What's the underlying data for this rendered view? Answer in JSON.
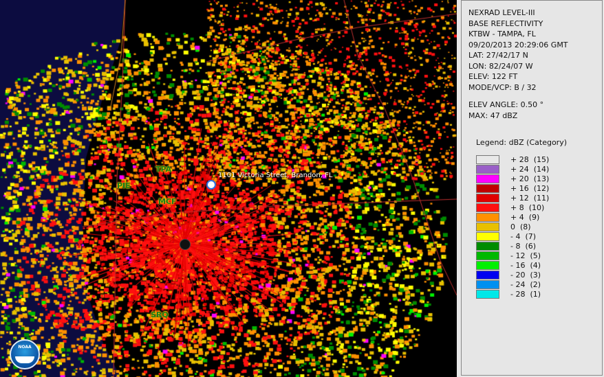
{
  "info": {
    "lines": [
      "NEXRAD LEVEL-III",
      "BASE REFLECTIVITY",
      "KTBW - TAMPA, FL",
      "09/20/2013 20:29:06 GMT",
      "LAT: 27/42/17 N",
      "LON: 82/24/07 W",
      "ELEV: 122 FT",
      "MODE/VCP: B / 32"
    ],
    "elev_angle": "ELEV ANGLE: 0.50 °",
    "max": "MAX: 47 dBZ"
  },
  "legend": {
    "title": "Legend: dBZ (Category)",
    "entries": [
      {
        "label": "+ 28  (15)",
        "color": "#e8e8e8"
      },
      {
        "label": "+ 24  (14)",
        "color": "#9a5fc8"
      },
      {
        "label": "+ 20  (13)",
        "color": "#ff00ff"
      },
      {
        "label": "+ 16  (12)",
        "color": "#c00000"
      },
      {
        "label": "+ 12  (11)",
        "color": "#e00000"
      },
      {
        "label": "+ 8  (10)",
        "color": "#ff1010"
      },
      {
        "label": "+ 4  (9)",
        "color": "#ff9000"
      },
      {
        "label": "0  (8)",
        "color": "#e8c000"
      },
      {
        "label": "- 4  (7)",
        "color": "#ffff00"
      },
      {
        "label": "- 8  (6)",
        "color": "#008c00"
      },
      {
        "label": "- 12  (5)",
        "color": "#00b800"
      },
      {
        "label": "- 16  (4)",
        "color": "#00f000"
      },
      {
        "label": "- 20  (3)",
        "color": "#0000f0"
      },
      {
        "label": "- 24  (2)",
        "color": "#0090f0"
      },
      {
        "label": "- 28  (1)",
        "color": "#00e8e8"
      }
    ]
  },
  "map": {
    "marker_label": "1101 Victoria Street, Brandon, FL",
    "sites": [
      "TPA",
      "PIE",
      "MCF",
      "SRQ"
    ],
    "logo_text": "NOAA",
    "icons": [
      "location-marker-icon",
      "radar-site-icon",
      "noaa-logo-icon"
    ]
  }
}
